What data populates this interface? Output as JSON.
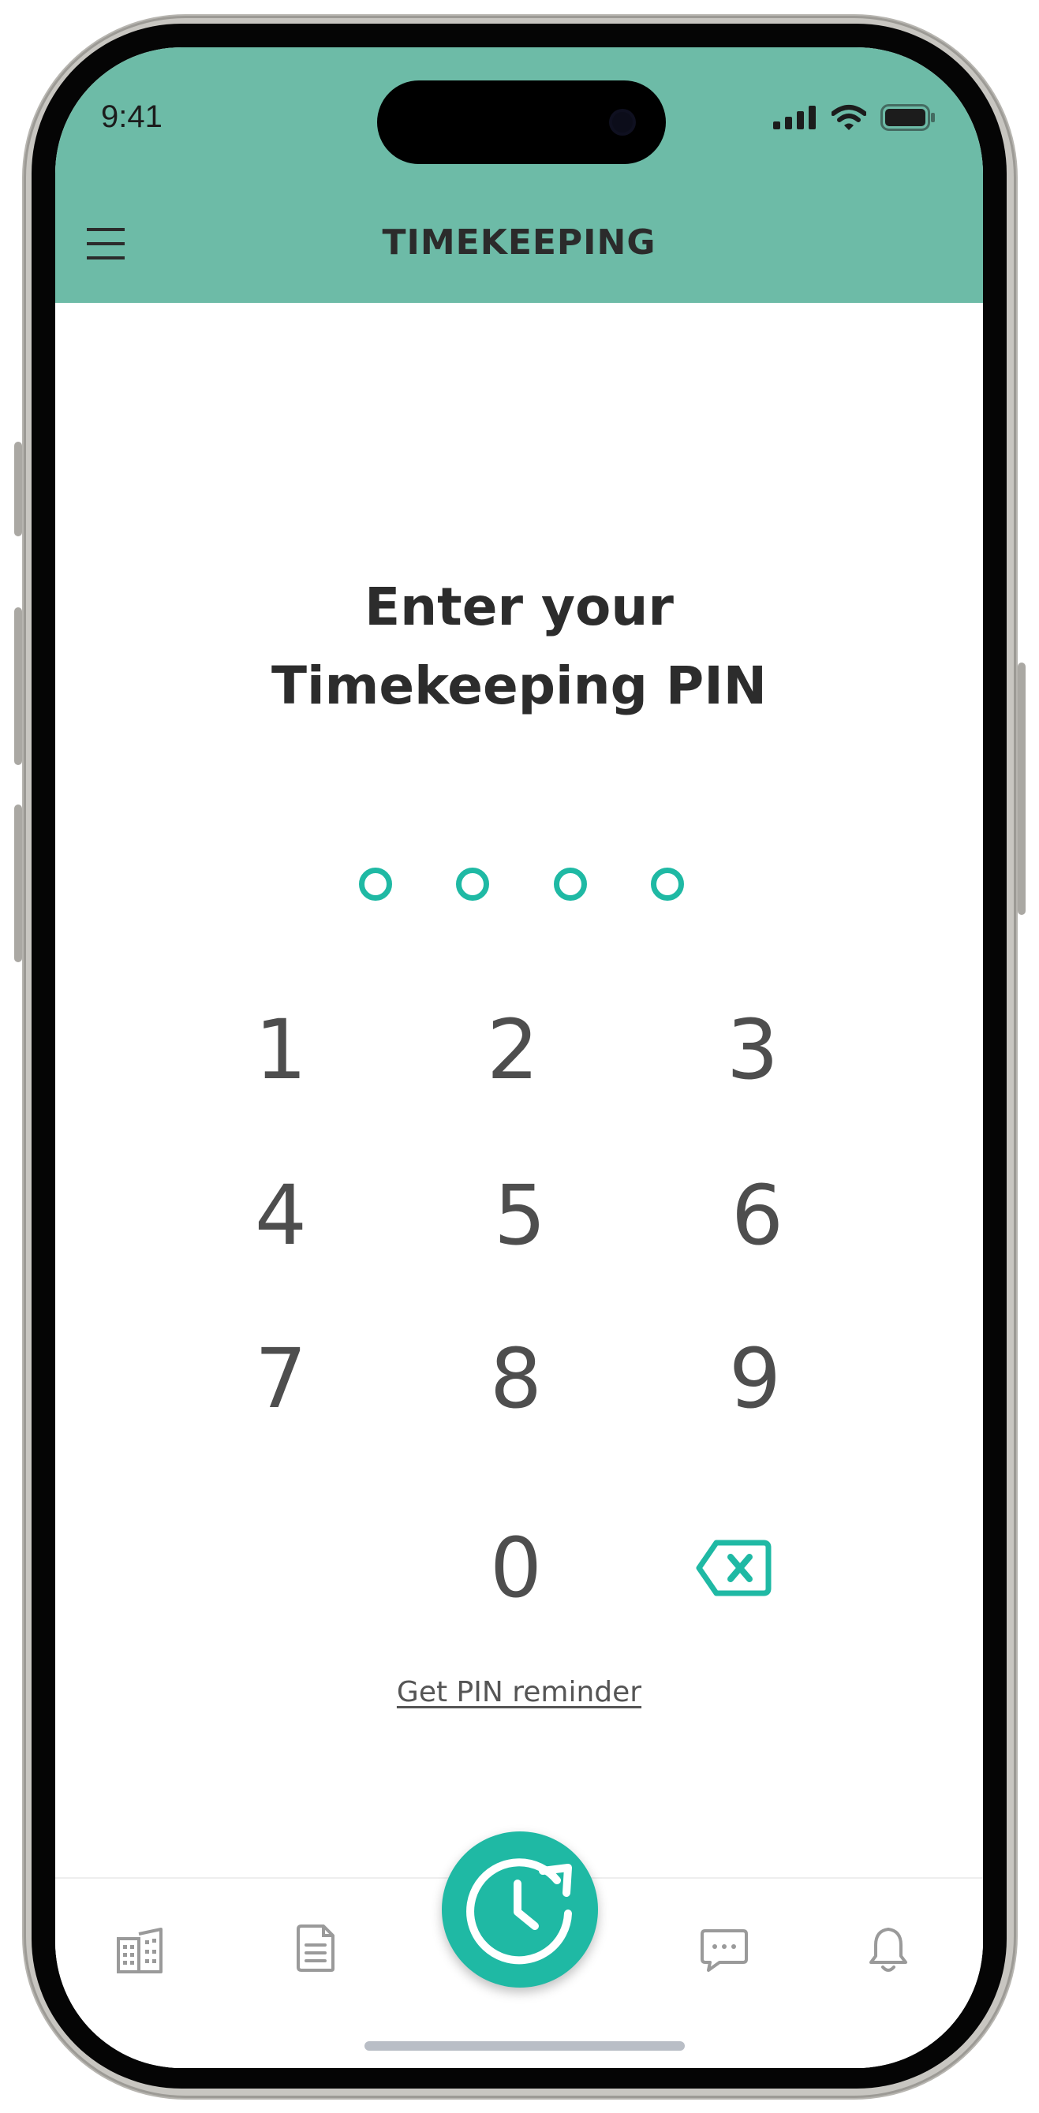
{
  "status_bar": {
    "time": "9:41"
  },
  "header": {
    "title": "TIMEKEEPING"
  },
  "pin_entry": {
    "prompt_line1": "Enter your",
    "prompt_line2": "Timekeeping PIN",
    "pin_length": 4,
    "digits_entered": 0
  },
  "keypad": {
    "keys": [
      "1",
      "2",
      "3",
      "4",
      "5",
      "6",
      "7",
      "8",
      "9",
      "0"
    ]
  },
  "reminder_link": "Get PIN reminder",
  "tabbar": {
    "items": [
      "buildings-icon",
      "document-icon",
      "clock-refresh-icon",
      "chat-icon",
      "bell-icon"
    ]
  },
  "colors": {
    "header_bg": "#6dbba7",
    "accent": "#1fb9a4",
    "key_text": "#4e4e4e",
    "tab_icon": "#9a9a9a"
  }
}
